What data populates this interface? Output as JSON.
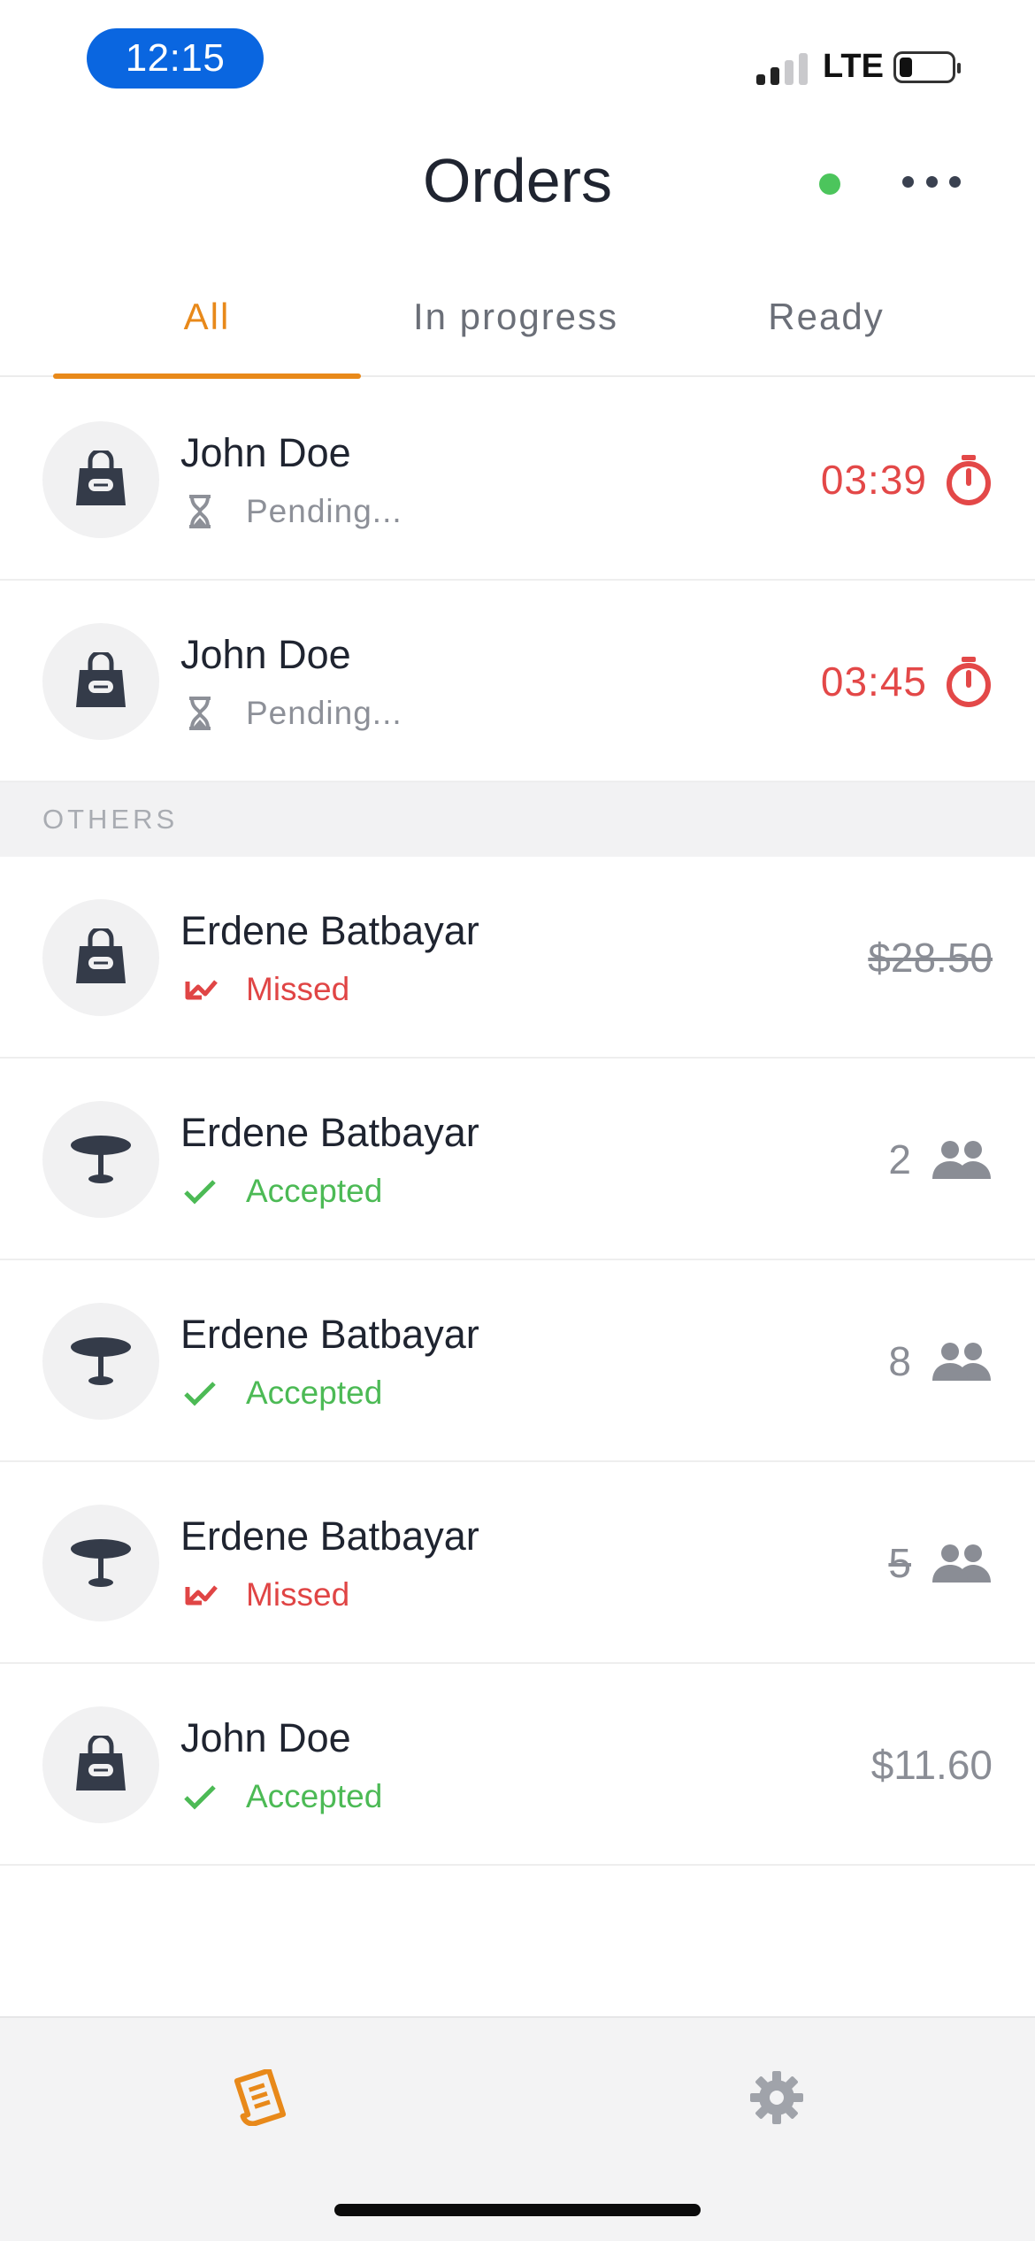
{
  "status_bar": {
    "time": "12:15",
    "network": "LTE",
    "battery_level": 0.25
  },
  "header": {
    "title": "Orders",
    "online": true
  },
  "tabs": [
    {
      "label": "All",
      "active": true
    },
    {
      "label": "In progress",
      "active": false
    },
    {
      "label": "Ready",
      "active": false
    }
  ],
  "pending_orders": [
    {
      "name": "John Doe",
      "status": "Pending...",
      "type": "takeaway",
      "timer": "03:39"
    },
    {
      "name": "John Doe",
      "status": "Pending...",
      "type": "takeaway",
      "timer": "03:45"
    }
  ],
  "others_section": {
    "label": "OTHERS"
  },
  "other_orders": [
    {
      "name": "Erdene Batbayar",
      "status": "Missed",
      "type": "takeaway",
      "price": "$28.50",
      "struck": true
    },
    {
      "name": "Erdene Batbayar",
      "status": "Accepted",
      "type": "table",
      "guests": "2",
      "struck": false
    },
    {
      "name": "Erdene Batbayar",
      "status": "Accepted",
      "type": "table",
      "guests": "8",
      "struck": false
    },
    {
      "name": "Erdene Batbayar",
      "status": "Missed",
      "type": "table",
      "guests": "5",
      "struck": true
    },
    {
      "name": "John Doe",
      "status": "Accepted",
      "type": "takeaway",
      "price": "$11.60",
      "struck": false
    }
  ],
  "tabbar": {
    "items": [
      "orders-icon",
      "settings-icon"
    ],
    "active": "orders-icon"
  },
  "colors": {
    "accent": "#e8891a",
    "danger": "#e04545",
    "success": "#4cba55",
    "online": "#4cc55c",
    "time_pill": "#0a66e0"
  }
}
